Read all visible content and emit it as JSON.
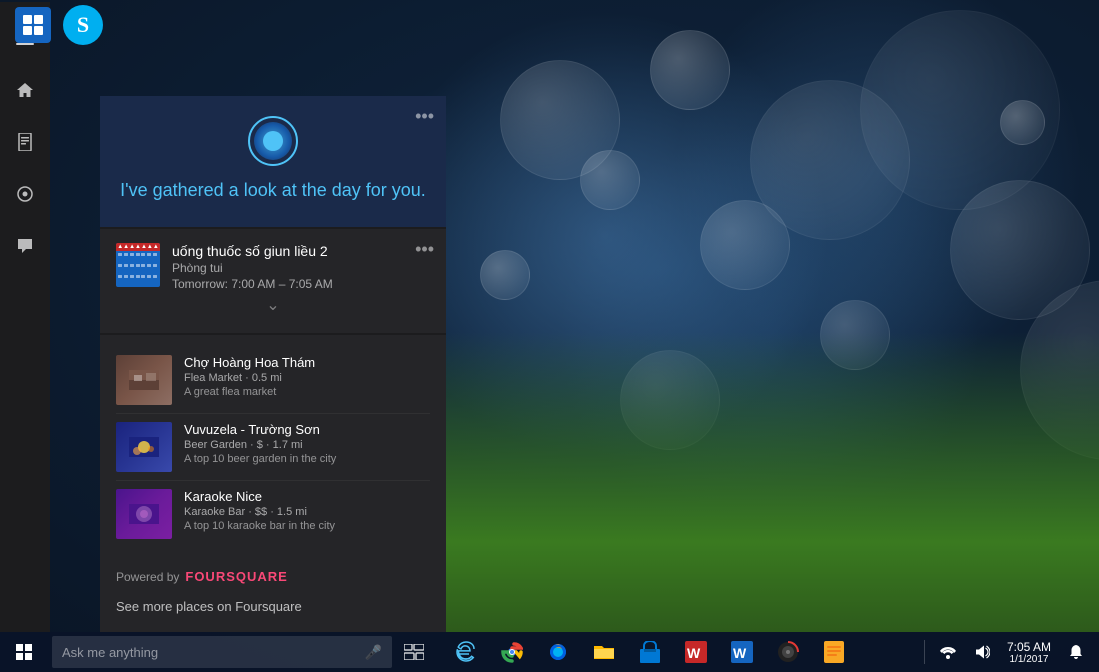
{
  "desktop": {
    "background": "dark blue bokeh wallpaper with green grass at bottom"
  },
  "cortana": {
    "greeting": "I've gathered a look at the day for you.",
    "ring_color": "#4fc3f7",
    "sidebar": {
      "items": [
        {
          "icon": "≡",
          "label": "hamburger-menu"
        },
        {
          "icon": "⌂",
          "label": "home"
        },
        {
          "icon": "☰",
          "label": "notebook"
        },
        {
          "icon": "✦",
          "label": "interests"
        },
        {
          "icon": "💬",
          "label": "feedback"
        }
      ]
    },
    "calendar_card": {
      "more_button": "•••",
      "event_title": "uống thuốc số giun liều 2",
      "room": "Phòng tui",
      "time": "Tomorrow: 7:00 AM – 7:05 AM",
      "expand": "˅"
    },
    "places_card": {
      "more_button": "•••",
      "places": [
        {
          "name": "Chợ Hoàng Hoa Thám",
          "type": "Flea Market · 0.5 mi",
          "desc": "A great flea market"
        },
        {
          "name": "Vuvuzela - Trường Sơn",
          "type": "Beer Garden · $ · 1.7 mi",
          "desc": "A top 10 beer garden in the city"
        },
        {
          "name": "Karaoke Nice",
          "type": "Karaoke Bar · $$ · 1.5 mi",
          "desc": "A top 10 karaoke bar in the city"
        }
      ],
      "powered_by": "Powered by",
      "foursquare": "FOURSQUARE",
      "see_more": "See more places on Foursquare"
    }
  },
  "taskbar": {
    "search_placeholder": "Ask me anything",
    "start_icon": "⊞"
  }
}
